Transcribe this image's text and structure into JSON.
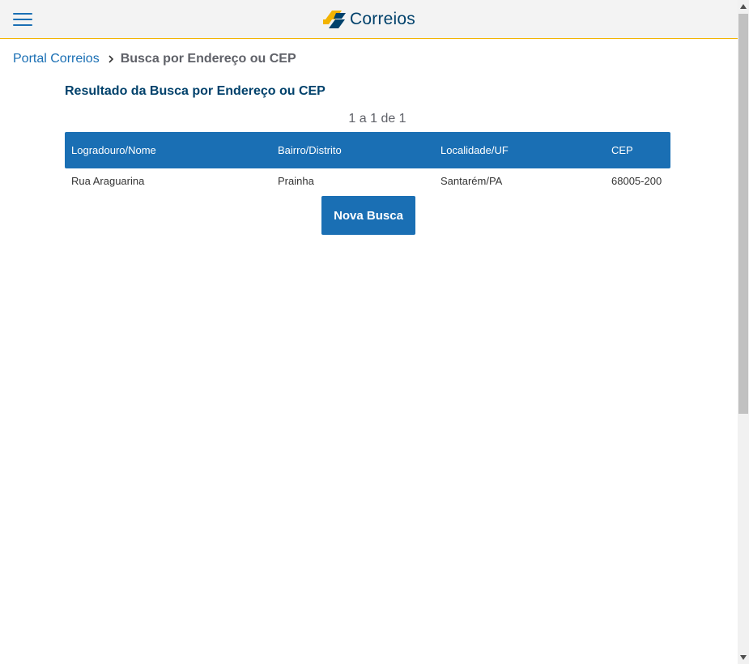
{
  "header": {
    "menu_icon": "hamburger-menu-icon",
    "logo_text": "Correios",
    "logo_colors": {
      "yellow": "#f2b301",
      "blue": "#00416b"
    }
  },
  "breadcrumb": {
    "home_label": "Portal Correios",
    "separator_icon": "chevron-right-icon",
    "current_label": "Busca por Endereço ou CEP"
  },
  "main": {
    "title": "Resultado da Busca por Endereço ou CEP",
    "pager": "1 a 1 de 1",
    "table": {
      "headers": [
        "Logradouro/Nome",
        "Bairro/Distrito",
        "Localidade/UF",
        "CEP"
      ],
      "rows": [
        [
          "Rua Araguarina",
          "Prainha",
          "Santarém/PA",
          "68005-200"
        ]
      ]
    },
    "new_search_label": "Nova Busca"
  },
  "colors": {
    "accent_blue": "#1a6fb4",
    "title_blue": "#00416b",
    "header_border": "#f2b301"
  }
}
